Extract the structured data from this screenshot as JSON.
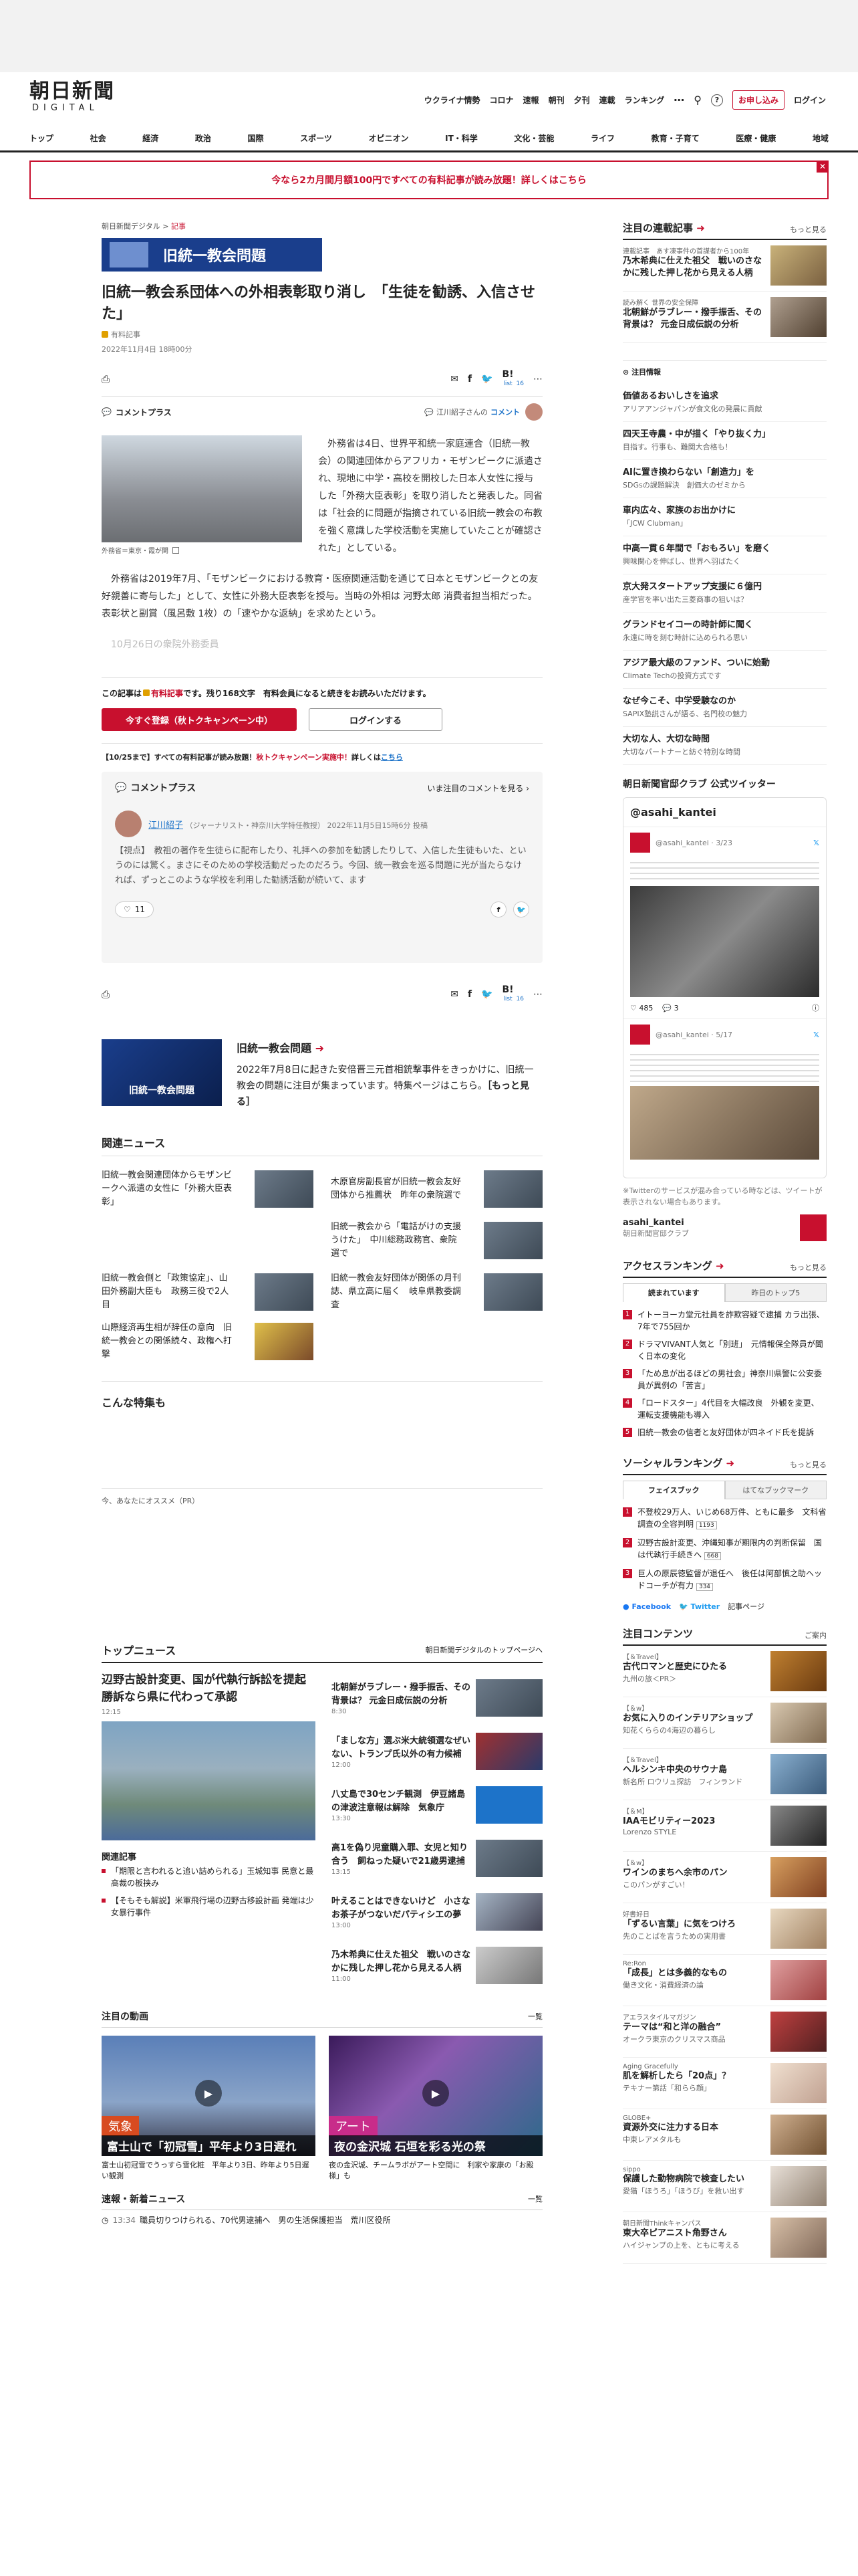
{
  "header": {
    "logo_main": "朝日新聞",
    "logo_sub": "DIGITAL",
    "nav": [
      "ウクライナ情勢",
      "コロナ",
      "速報",
      "朝刊",
      "夕刊",
      "連載",
      "ランキング"
    ],
    "subscribe": "お申し込み",
    "login": "ログイン"
  },
  "categories": [
    "トップ",
    "社会",
    "経済",
    "政治",
    "国際",
    "スポーツ",
    "オピニオン",
    "IT・科学",
    "文化・芸能",
    "ライフ",
    "教育・子育て",
    "医療・健康",
    "地域"
  ],
  "banner": "今なら2カ月間月額100円ですべての有料記事が読み放題！詳しくはこちら",
  "article": {
    "breadcrumb": [
      "朝日新聞デジタル",
      "記事"
    ],
    "special_badge": "旧統一教会問題",
    "title": "旧統一教会系団体への外相表彰取り消し　「生徒を勧誘、入信させた」",
    "paid_label": "有料記事",
    "date": "2022年11月4日 18時00分",
    "list_label": "list",
    "count": "16",
    "comment_plus": "コメントプラス",
    "commenter_note": "江川紹子さんの",
    "commenter_link": "コメント",
    "photo_caption": "外務省＝東京・霞が関",
    "lead": "　外務省は4日、世界平和統一家庭連合（旧統一教会）の関連団体からアフリカ・モザンビークに派遣され、現地に中学・高校を開校した日本人女性に授与した「外務大臣表彰」を取り消したと発表した。同省は「社会的に問題が指摘されている旧統一教会の布教を強く意識した学校活動を実施していたことが確認された」としている。",
    "para2": "　外務省は2019年7月、「モザンビークにおける教育・医療関連活動を通じて日本とモザンビークとの友好親善に寄与した」として、女性に外務大臣表彰を授与。当時の外相は 河野太郎 消費者担当相だった。表彰状と副賞（風呂敷 1枚）の「速やかな返納」を求めたという。",
    "para3_fade": "　10月26日の衆院外務委員",
    "paywall_pre": "この記事は",
    "paywall_paid": "有料記事",
    "paywall_post": "です。残り168文字　有料会員になると続きをお読みいただけます。",
    "register_btn": "今すぐ登録（秋トクキャンペーン中）",
    "login_btn": "ログインする",
    "promo_pre": "【10/25まで】すべての有料記事が読み放題！",
    "promo_red": "秋トクキャンペーン実施中！",
    "promo_post": "詳しくは",
    "promo_link": "こちら"
  },
  "comment_box": {
    "title": "コメントプラス",
    "see_all": "いま注目のコメントを見る",
    "name": "江川紹子",
    "role": "（ジャーナリスト・神奈川大学特任教授）",
    "time": "2022年11月5日15時6分 投稿",
    "text": "【視点】　教祖の著作を生徒らに配布したり、礼拝への参加を勧誘したりして、入信した生徒もいた、というのには驚く。まさにそのための学校活動だったのだろう。今回、統一教会を巡る問題に光が当たらなければ、ずっとこのような学校を利用した勧誘活動が続いて、ます",
    "likes": "11"
  },
  "special": {
    "title": "旧統一教会問題",
    "thumb": "旧統一教会問題",
    "text": "2022年7月8日に起きた安倍晋三元首相銃撃事件をきっかけに、旧統一教会の問題に注目が集まっています。特集ページはこちら。",
    "more": "［もっと見る］"
  },
  "related": {
    "title": "関連ニュース",
    "items": [
      "旧統一教会関連団体からモザンビークへ派遣の女性に「外務大臣表彰」",
      "木原官房副長官が旧統一教会友好団体から推薦状　昨年の衆院選で",
      "旧統一教会から「電話がけの支援うけた」　中川総務政務官、衆院選で",
      "旧統一教会側と「政策協定」、山田外務副大臣も　政務三役で2人目",
      "旧統一教会友好団体が関係の月刊誌、県立高に届く　岐阜県教委調査",
      "山際経済再生相が辞任の意向　旧統一教会との関係続々、政権へ打撃"
    ]
  },
  "feature_title": "こんな特集も",
  "pr_label": "今、あなたにオススメ（PR）",
  "top_news": {
    "title": "トップニュース",
    "more": "朝日新聞デジタルのトップページへ",
    "lead_title": "辺野古設計変更、国が代執行訴訟を提起　勝訴なら県に代わって承認",
    "lead_time": "12:15",
    "related_label": "関連記事",
    "related": [
      "「期限と言われると追い詰められる」玉城知事 民意と最高裁の板挟み",
      "【そもそも解説】米軍飛行場の辺野古移設計画 発端は少女暴行事件"
    ],
    "items": [
      {
        "t": "北朝鮮がラブレー・撥手振舌、その背景は？ 元金日成伝説の分析",
        "time": "8:30"
      },
      {
        "t": "「ましな方」選ぶ米大統領選なぜいない、トランプ氏以外の有力候補",
        "time": "12:00"
      },
      {
        "t": "八丈島で30センチ観測　伊豆諸島の津波注意報は解除　気象庁",
        "time": "13:30"
      },
      {
        "t": "高1を偽り児童購入罪、女児と知り合う　飼ねった疑いで21歳男逮捕",
        "time": "13:15"
      },
      {
        "t": "叶えることはできないけど　小さなお茶子がつないだパティシエの夢",
        "time": "13:00"
      },
      {
        "t": "乃木希典に仕えた祖父　戦いのさなかに残した押し花から見える人柄",
        "time": "11:00"
      }
    ]
  },
  "videos": {
    "title": "注目の動画",
    "more": "一覧",
    "items": [
      {
        "tag": "気象",
        "caption": "富士山で「初冠雪」平年より3日遅れ",
        "desc": "富士山初冠雪でうっすら雪化粧　平年より3日、昨年より5日遅い観測"
      },
      {
        "tag": "アート",
        "caption": "夜の金沢城 石垣を彩る光の祭",
        "desc": "夜の金沢城、チームラボがアート空間に　利家や家康の「お殿様」も"
      }
    ]
  },
  "flash": {
    "title": "速報・新着ニュース",
    "more": "一覧",
    "first_time": "13:34",
    "first": "職員切りつけられる、70代男逮捕へ　男の生活保護担当　荒川区役所"
  },
  "sidebar": {
    "series": {
      "title": "注目の連載記事",
      "more": "もっと見る",
      "items": [
        {
          "tag": "連載記事　あす凍事件の首謀者から100年",
          "t": "乃木希典に仕えた祖父　戦いのさなかに残した押し花から見える人柄"
        },
        {
          "tag": "読み解く 世界の安全保障",
          "t": "北朝鮮がラブレー・撥手振舌、その背景は？ 元金日成伝説の分析"
        }
      ]
    },
    "pr": {
      "title": "注目情報",
      "items": [
        {
          "t": "価値あるおいしさを追求",
          "s": "アリアアンジャパンが食文化の発展に貢献"
        },
        {
          "t": "四天王寺農・中が描く「やり抜く力」",
          "s": "目指す。行事も、難関大合格も！"
        },
        {
          "t": "AIに置き換わらない「創造力」を",
          "s": "SDGsの課題解決　創価大のゼミから"
        },
        {
          "t": "車内広々、家族のお出かけに",
          "s": "「JCW Clubman」"
        },
        {
          "t": "中高一貫６年間で「おもろい」を磨く",
          "s": "興味関心を伸ばし、世界へ羽ばたく"
        },
        {
          "t": "京大発スタートアップ支援に６億円",
          "s": "産学官を率い出た三菱商事の狙いは？"
        },
        {
          "t": "グランドセイコーの時計師に聞く",
          "s": "永遠に時を刻む時計に込められる思い"
        },
        {
          "t": "アジア最大級のファンド、ついに始動",
          "s": "Climate Techの投資方式です"
        },
        {
          "t": "なぜ今こそ、中学受験なのか",
          "s": "SAPIX塾説さんが語る、名門校の魅力"
        },
        {
          "t": "大切な人、大切な時間",
          "s": "大切なパートナーと紡ぐ特別な時間"
        }
      ]
    },
    "twitter": {
      "title": "朝日新聞官邸クラブ 公式ツイッター",
      "account": "@asahi_kantei",
      "handle1": "@asahi_kantei · 3/23",
      "handle2": "@asahi_kantei · 5/17",
      "likes": "485",
      "replies": "3",
      "note": "※Twitterのサービスが混み合っている時などは、ツイートが表示されない場合もあります。",
      "name": "asahi_kantei",
      "club": "朝日新聞官邸クラブ"
    },
    "access": {
      "title": "アクセスランキング",
      "more": "もっと見る",
      "tab1": "読まれています",
      "tab2": "昨日のトップ5",
      "items": [
        "イトーヨーカ堂元社員を詐欺容疑で逮捕 カラ出張、7年で755回か",
        "ドラマVIVANT人気と「別班」　元情報保全隊員が聞く日本の変化",
        "「ため息が出るほどの男社会」神奈川県警に公安委員が異例の「苦言」",
        "「ロードスター」4代目を大幅改良　外観を変更、運転支援機能も導入",
        "旧統一教会の信者と友好団体が四ネイド氏を提訴"
      ]
    },
    "social": {
      "title": "ソーシャルランキング",
      "more": "もっと見る",
      "tab1": "フェイスブック",
      "tab2": "はてなブックマーク",
      "items": [
        {
          "t": "不登校29万人、いじめ68万件、ともに最多　文科省調査の全容判明",
          "c": "1193"
        },
        {
          "t": "辺野古設計変更、沖縄知事が期限内の判断保留　国は代執行手続きへ",
          "c": "668"
        },
        {
          "t": "巨人の原辰徳監督が退任へ　後任は阿部慎之助ヘッドコーチが有力",
          "c": "334"
        }
      ],
      "fb": "Facebook",
      "tw": "Twitter",
      "feed": "記事ページ"
    },
    "contents": {
      "title": "注目コンテンツ",
      "more": "ご案内",
      "items": [
        {
          "tag": "【＆Travel】",
          "t": "古代ロマンと歴史にひたる",
          "s": "九州の旅＜PR＞"
        },
        {
          "tag": "【＆w】",
          "t": "お気に入りのインテリアショップ",
          "s": "知花くららの4海辺の暮らし"
        },
        {
          "tag": "【＆Travel】",
          "t": "ヘルシンキ中央のサウナ島",
          "s": "新名所 ロウリュ探訪　フィンランド"
        },
        {
          "tag": "【＆M】",
          "t": "IAAモビリティー2023",
          "s": "Lorenzo STYLE"
        },
        {
          "tag": "【＆w】",
          "t": "ワインのまちへ余市のパン",
          "s": "このパンがすごい！"
        },
        {
          "tag": "好書好日",
          "t": "「ずるい言葉」に気をつけろ",
          "s": "先のことばを言うための実用書"
        },
        {
          "tag": "Re:Ron",
          "t": "「成長」とは多義的なもの",
          "s": "働き文化・消費経済の論"
        },
        {
          "tag": "アエラスタイルマガジン",
          "t": "テーマは“和と洋の融合”",
          "s": "オークラ東京のクリスマス商品"
        },
        {
          "tag": "Aging Gracefully",
          "t": "肌を解析したら「20点」？",
          "s": "テキナー第話「和らら顔」"
        },
        {
          "tag": "GLOBE+",
          "t": "資源外交に注力する日本",
          "s": "中東レアメタルも"
        },
        {
          "tag": "sippo",
          "t": "保護した動物病院で検査したい",
          "s": "愛猫「ほうろ」「ほうび」を救い出す"
        },
        {
          "tag": "朝日新聞Thinkキャンパス",
          "t": "東大卒ピアニスト角野さん",
          "s": "ハイジャンプの上を、ともに考える"
        }
      ]
    }
  },
  "colors": {
    "brand_red": "#c8102e",
    "special_blue": "#1a3e8c",
    "twitter_blue": "#1d9bf0"
  }
}
